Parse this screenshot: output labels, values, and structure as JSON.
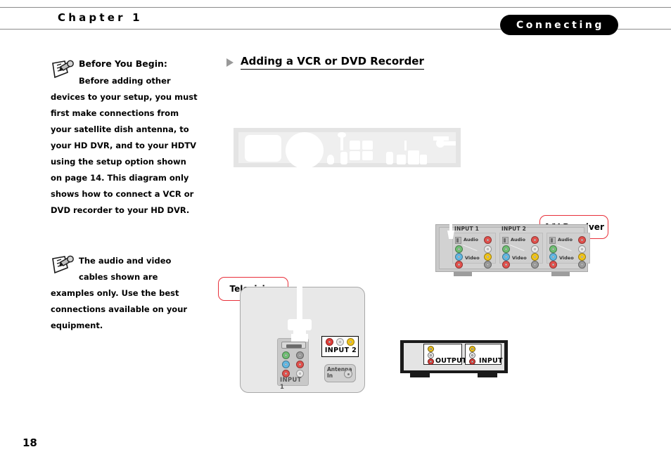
{
  "header": {
    "chapter_label": "Chapter 1",
    "section_badge": "Connecting",
    "badge_bg": "#000000",
    "rule_color": "#8a8a8a"
  },
  "main": {
    "heading": "Adding a VCR or DVD Recorder",
    "arrow_icon": "triangle-right-icon",
    "arrow_color": "#999999"
  },
  "notes": [
    {
      "icon": "note-pencil-icon",
      "title": "Before You Begin:",
      "body": "Before adding other devices to your setup, you must first make connections from your satellite dish antenna, to your HD DVR, and to your HDTV using the setup option shown on page 14. This diagram only shows how to connect a VCR or DVD recorder to your HD DVR."
    },
    {
      "icon": "note-pencil-icon",
      "title": "",
      "body": "The audio and video cables shown are examples only. Use the best connections available on your equipment."
    }
  ],
  "diagram": {
    "callouts": [
      {
        "id": "av-receiver",
        "label": "A/V Receiver",
        "border_color": "#e8303a"
      },
      {
        "id": "television",
        "label": "Television",
        "border_color": "#e8303a"
      }
    ],
    "dvr": {
      "name": "HD DVR rear panel",
      "style": "ghosted",
      "fill": "#e6e6e6"
    },
    "av_receiver": {
      "name": "A/V Receiver rear panel",
      "groups": [
        {
          "label": "INPUT 1",
          "audio_label": "Audio",
          "video_label": "Video",
          "jacks": [
            {
              "type": "optical",
              "color": "#b8b8b8"
            },
            {
              "type": "rca",
              "color": "#e2504c"
            },
            {
              "type": "rca",
              "color": "#6fbf73"
            },
            {
              "type": "rca",
              "color": "#e9e9e9"
            },
            {
              "type": "rca",
              "color": "#62b8e3"
            },
            {
              "type": "rca",
              "color": "#f0c419"
            },
            {
              "type": "rca",
              "color": "#e2504c"
            },
            {
              "type": "rca",
              "color": "#9a9a9a"
            }
          ]
        },
        {
          "label": "INPUT 2",
          "audio_label": "Audio",
          "video_label": "Video",
          "jacks": [
            {
              "type": "optical",
              "color": "#b8b8b8"
            },
            {
              "type": "rca",
              "color": "#e2504c"
            },
            {
              "type": "rca",
              "color": "#6fbf73"
            },
            {
              "type": "rca",
              "color": "#e9e9e9"
            },
            {
              "type": "rca",
              "color": "#62b8e3"
            },
            {
              "type": "rca",
              "color": "#f0c419"
            },
            {
              "type": "rca",
              "color": "#e2504c"
            },
            {
              "type": "rca",
              "color": "#9a9a9a"
            }
          ]
        },
        {
          "label": "",
          "audio_label": "Audio",
          "video_label": "Video",
          "jacks": [
            {
              "type": "optical",
              "color": "#b8b8b8"
            },
            {
              "type": "rca",
              "color": "#e2504c"
            },
            {
              "type": "rca",
              "color": "#6fbf73"
            },
            {
              "type": "rca",
              "color": "#e9e9e9"
            },
            {
              "type": "rca",
              "color": "#62b8e3"
            },
            {
              "type": "rca",
              "color": "#f0c419"
            },
            {
              "type": "rca",
              "color": "#e2504c"
            },
            {
              "type": "rca",
              "color": "#9a9a9a"
            }
          ]
        }
      ],
      "cable": "white-optical-cable"
    },
    "television": {
      "name": "Television rear panel",
      "input1_label": "INPUT 1",
      "input2_label": "INPUT 2",
      "antenna_label": "Antenna\nIn",
      "antenna_label_line1": "Antenna",
      "antenna_label_line2": "In",
      "input1_jacks": [
        {
          "color": "#6fbf73"
        },
        {
          "color": "#9a9a9a"
        },
        {
          "color": "#62b8e3"
        },
        {
          "color": "#e2504c"
        },
        {
          "color": "#e2504c"
        },
        {
          "color": "#e9e9e9"
        }
      ],
      "input2_jacks": [
        {
          "color": "#e03c38"
        },
        {
          "color": "#e9e9e9"
        },
        {
          "color": "#f0c419"
        }
      ],
      "cable": "white-dsub-cable"
    },
    "vcr": {
      "name": "VCR or DVD Recorder",
      "output_label": "OUTPUT",
      "input_label": "INPUT",
      "output_jacks": [
        {
          "color": "#f0c419"
        },
        {
          "color": "#e9e9e9"
        },
        {
          "color": "#e03c38"
        }
      ],
      "input_jacks": [
        {
          "color": "#f0c419"
        },
        {
          "color": "#e9e9e9"
        },
        {
          "color": "#e03c38"
        }
      ]
    }
  },
  "footer": {
    "page_number": "18"
  }
}
